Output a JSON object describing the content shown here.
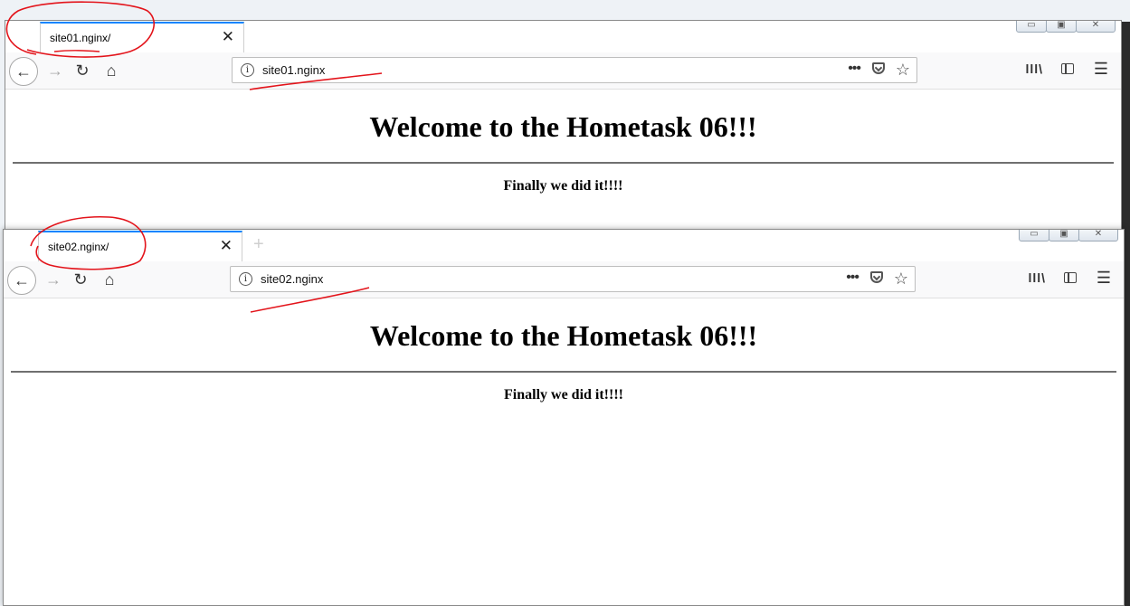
{
  "colors": {
    "tab_accent": "#0a84ff",
    "annotation": "#e3141b"
  },
  "windows": [
    {
      "tab_title": "site01.nginx/",
      "tab_close_icon": "close-icon",
      "address": "site01.nginx",
      "page": {
        "heading": "Welcome to the Hometask 06!!!",
        "text": "Finally we did it!!!!"
      }
    },
    {
      "tab_title": "site02.nginx/",
      "tab_close_icon": "close-icon",
      "address": "site02.nginx",
      "page": {
        "heading": "Welcome to the Hometask 06!!!",
        "text": "Finally we did it!!!!"
      }
    }
  ],
  "toolbar_icons": [
    "back-arrow-icon",
    "forward-arrow-icon",
    "reload-icon",
    "home-icon",
    "page-info-icon",
    "page-actions-icon",
    "pocket-icon",
    "bookmark-star-icon",
    "library-icon",
    "sidebar-icon",
    "hamburger-menu-icon"
  ],
  "window_controls": [
    "minimize-icon",
    "maximize-icon",
    "close-icon"
  ]
}
